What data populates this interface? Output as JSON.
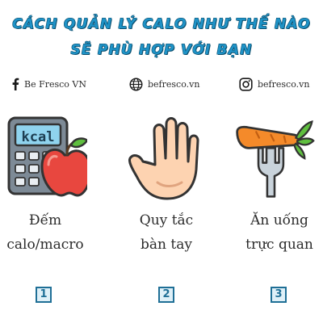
{
  "title": {
    "line1": "CÁCH QUẢN LÝ CALO NHƯ THẾ NÀO",
    "line2": "SẼ PHÙ HỢP VỚI BẠN"
  },
  "social": [
    {
      "icon": "facebook-icon",
      "text": "Be Fresco VN"
    },
    {
      "icon": "globe-icon",
      "text": "befresco.vn"
    },
    {
      "icon": "instagram-icon",
      "text": "befresco.vn"
    }
  ],
  "methods": [
    {
      "icon": "calculator-apple-icon",
      "kcal_text": "kcal",
      "line1": "Đếm",
      "line2": "calo/macro",
      "number": "1"
    },
    {
      "icon": "hand-icon",
      "line1": "Quy tắc",
      "line2": "bàn tay",
      "number": "2"
    },
    {
      "icon": "fork-carrot-icon",
      "line1": "Ăn uống",
      "line2": "trực quan",
      "number": "3"
    }
  ],
  "colors": {
    "title": "#1f93c7",
    "title_shadow": "#0d4f6e",
    "number_border": "#1f6f96",
    "number_fill": "#dff0f8"
  }
}
